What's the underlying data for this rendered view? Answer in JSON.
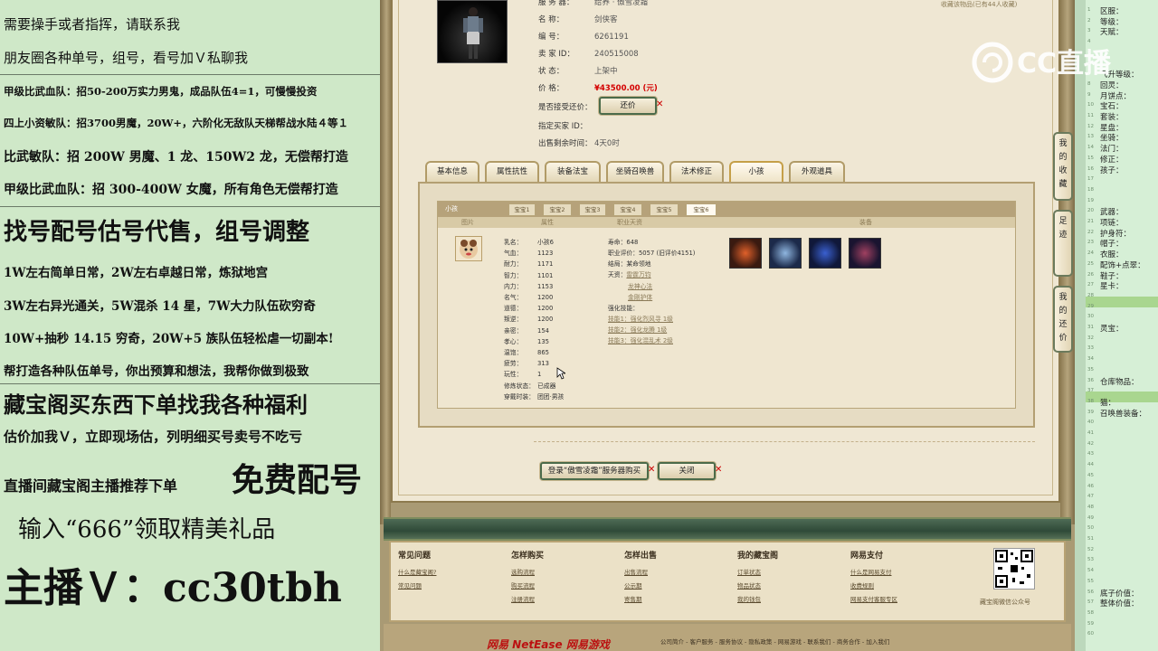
{
  "left_panel": {
    "lines": [
      "需要操手或者指挥，请联系我",
      "朋友圈各种单号，组号，看号加Ｖ私聊我",
      "甲级比武血队：招50-200万实力男鬼，成品队伍4=1，可慢慢投资",
      "四上小资敏队：招3700男魔，20W+，六阶化无敌队天梯帮战水陆４等１",
      "比武敏队：招 200W 男魔、1 龙、150W2 龙，无偿帮打造",
      "甲级比武血队：招 300-400W 女魔，所有角色无偿帮打造",
      "找号配号估号代售，组号调整",
      "1W左右简单日常，2W左右卓越日常，炼狱地宫",
      "3W左右异光通关，5W混杀 14 星，7W大力队伍砍穷奇",
      "10W+抽秒 14.15 穷奇，20W+5 族队伍轻松虐一切副本!",
      "帮打造各种队伍单号，你出预算和想法，我帮你做到极致",
      "藏宝阁买东西下单找我各种福利",
      "估价加我Ｖ，立即现场估，列明细买号卖号不吃亏",
      "直播间藏宝阁主播推荐下单",
      "免费配号",
      "输入“666”领取精美礼品",
      "主播Ｖ：cc30tbh"
    ]
  },
  "item": {
    "server_label": "服 务 器：",
    "server_value": "给养 · 傲雪凌霜",
    "name_label": "名 称：",
    "name_value": "剑侠客",
    "id_label": "编 号：",
    "id_value": "6261191",
    "seller_label": "卖 家 ID：",
    "seller_value": "240515008",
    "status_label": "状 态：",
    "status_value": "上架中",
    "price_label": "价 格：",
    "price_value": "¥43500.00 (元)",
    "bargain_label": "是否接受还价：",
    "bargain_button": "还价",
    "buyer_label": "指定买家 ID：",
    "time_label": "出售剩余时间：",
    "time_value": "4天0时",
    "fav_link": "收藏该物品(已有44人收藏)"
  },
  "main_tabs": [
    "基本信息",
    "属性抗性",
    "装备法宝",
    "坐骑召唤兽",
    "法术修正",
    "小孩",
    "外观道具"
  ],
  "active_main_tab": 5,
  "child_panel": {
    "header_label": "小孩",
    "sub_tabs": [
      "宝宝1",
      "宝宝2",
      "宝宝3",
      "宝宝4",
      "宝宝5",
      "宝宝6"
    ],
    "active_sub_tab": 5,
    "columns": [
      "图片",
      "属性",
      "职业天资",
      "装备"
    ],
    "stats": [
      {
        "k": "乳名：",
        "v": "小孩6"
      },
      {
        "k": "气血：",
        "v": "1123"
      },
      {
        "k": "耐力：",
        "v": "1171"
      },
      {
        "k": "智力：",
        "v": "1101"
      },
      {
        "k": "内力：",
        "v": "1153"
      },
      {
        "k": "名气：",
        "v": "1200"
      },
      {
        "k": "道德：",
        "v": "1200"
      },
      {
        "k": "叛逆：",
        "v": "1200"
      },
      {
        "k": "亲密：",
        "v": "154"
      },
      {
        "k": "孝心：",
        "v": "135"
      },
      {
        "k": "温饱：",
        "v": "865"
      },
      {
        "k": "疲劳：",
        "v": "313"
      },
      {
        "k": "玩性：",
        "v": "1"
      },
      {
        "k": "修炼状态：",
        "v": "已成器"
      },
      {
        "k": "穿戴时装：",
        "v": "团团·男孩"
      }
    ],
    "lifespan_label": "寿命：",
    "lifespan_value": "648",
    "career_label": "职业评价：",
    "career_value": "5057 (旧评价4151)",
    "ending_label": "结局：",
    "ending_value": "某命领地",
    "talent_label": "天资：",
    "talents": [
      "雷霆万钧",
      "龙神心法",
      "金刚护体"
    ],
    "skill_label": "强化技能：",
    "skills": [
      "技能1：强化烈风寻 1级",
      "技能2：强化龙腾 1级",
      "技能3：强化混乱术 2级"
    ]
  },
  "actions": {
    "login_button": "登录“傲雪凌霜”服务器购买",
    "close_button": "关闭"
  },
  "side_tabs": [
    "我的收藏",
    "足迹",
    "我的还价"
  ],
  "right_panel": {
    "labels": [
      {
        "row": 1,
        "text": "区服："
      },
      {
        "row": 2,
        "text": "等级："
      },
      {
        "row": 3,
        "text": "天赋："
      },
      {
        "row": 7,
        "text": "飞升等级："
      },
      {
        "row": 8,
        "text": "回灵："
      },
      {
        "row": 9,
        "text": "月饼点："
      },
      {
        "row": 10,
        "text": "宝石："
      },
      {
        "row": 11,
        "text": "套装："
      },
      {
        "row": 12,
        "text": "星盘："
      },
      {
        "row": 13,
        "text": "坐骑："
      },
      {
        "row": 14,
        "text": "法门："
      },
      {
        "row": 15,
        "text": "修正："
      },
      {
        "row": 16,
        "text": "孩子："
      },
      {
        "row": 20,
        "text": "武器："
      },
      {
        "row": 21,
        "text": "项链："
      },
      {
        "row": 22,
        "text": "护身符："
      },
      {
        "row": 23,
        "text": "帽子："
      },
      {
        "row": 24,
        "text": "衣服："
      },
      {
        "row": 25,
        "text": "配饰+点翠："
      },
      {
        "row": 26,
        "text": "鞋子："
      },
      {
        "row": 27,
        "text": "星卡："
      },
      {
        "row": 31,
        "text": "灵宝："
      },
      {
        "row": 36,
        "text": "仓库物品："
      },
      {
        "row": 38,
        "text": "猫："
      },
      {
        "row": 39,
        "text": "召唤兽装备："
      },
      {
        "row": 56,
        "text": "底子价值："
      },
      {
        "row": 57,
        "text": "整体价值："
      }
    ],
    "highlight_rows": [
      27,
      36
    ]
  },
  "watermark": {
    "text": "CC直播"
  },
  "footer": {
    "columns": [
      {
        "title": "常见问题",
        "links": [
          "什么是藏宝阁?",
          "常见问题"
        ]
      },
      {
        "title": "怎样购买",
        "links": [
          "选购流程",
          "购买流程",
          "注册流程"
        ]
      },
      {
        "title": "怎样出售",
        "links": [
          "出售流程",
          "公示期",
          "寄售期"
        ]
      },
      {
        "title": "我的藏宝阁",
        "links": [
          "订单状态",
          "物品状态",
          "我的钱包"
        ]
      },
      {
        "title": "网易支付",
        "links": [
          "什么是网易支付",
          "收费规则",
          "网易支付客服专区"
        ]
      }
    ],
    "qr_caption": "藏宝阁微信公众号",
    "copyright": "公司简介 - 客户服务 - 服务协议 - 隐私政策 - 网易游戏 - 联系我们 - 商务合作 - 加入我们",
    "logo_text": "网易 NetEase 网易游戏"
  }
}
